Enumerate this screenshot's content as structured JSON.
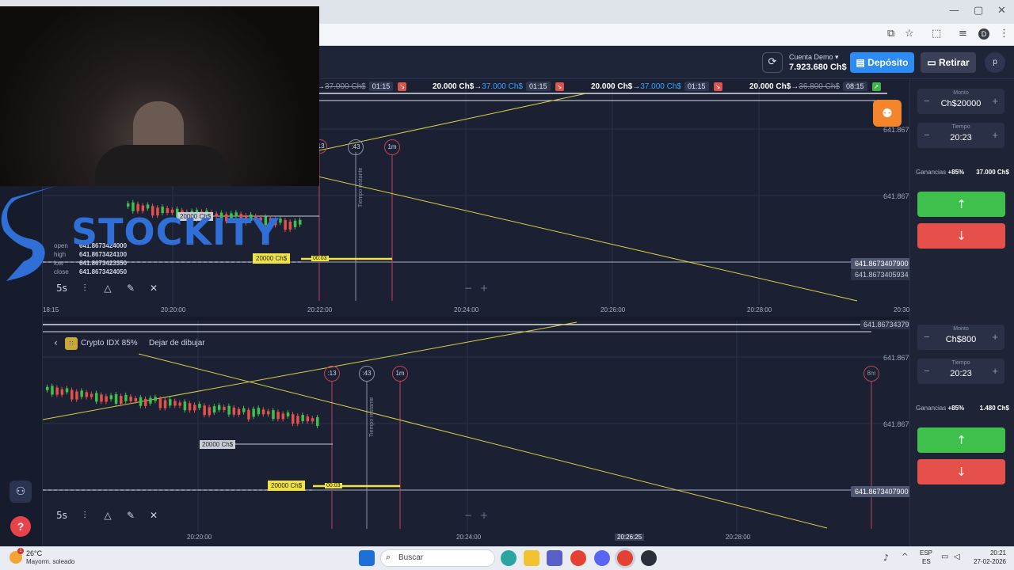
{
  "browser": {
    "window_min": "—",
    "window_max": "▢",
    "window_close": "✕",
    "profile_initial": "D"
  },
  "header": {
    "account_label": "Cuenta Demo",
    "account_balance": "7.923.680 Ch$",
    "deposit_label": "Depósito",
    "withdraw_label": "Retirar",
    "avatar_initial": "p"
  },
  "ticker": [
    {
      "from": "",
      "old": "37.000 Ch$",
      "new": "",
      "time": "01:15",
      "direction": "down"
    },
    {
      "from": "20.000 Ch$",
      "old": "",
      "new": "37.000 Ch$",
      "time": "01:15",
      "direction": "down"
    },
    {
      "from": "20.000 Ch$",
      "old": "",
      "new": "37.000 Ch$",
      "time": "01:15",
      "direction": "down"
    },
    {
      "from": "20.000 Ch$",
      "old": "36.800 Ch$",
      "new": "",
      "time": "08:15",
      "direction": "up"
    }
  ],
  "chart_top": {
    "price_labels": [
      "641.8673",
      "641.8673",
      "641.8673"
    ],
    "current_price": "641.8673407900",
    "sub_price": "641.8673405934",
    "trade_tag": "20000 Ch$",
    "trade_tag_faded": "20000 Ch$",
    "trade_timer": "00:03",
    "markers": [
      ":13",
      ":43",
      "1m"
    ],
    "vertical_label": "Tiempo restante",
    "ohlc": {
      "open": "641.8673424000",
      "high": "641.8673424100",
      "low": "641.8673423350",
      "close": "641.8673424050"
    },
    "ohlc_labels": {
      "open": "open",
      "high": "high",
      "low": "low",
      "close": "close"
    },
    "interval": "5s",
    "times": [
      "18:15",
      "20:20:00",
      "20:22:00",
      "20:24:00",
      "20:26:00",
      "20:28:00",
      "20:30"
    ]
  },
  "chart_bottom": {
    "top_price": "641.8673437963",
    "price_labels": [
      "641.8673",
      "641.8673"
    ],
    "current_price": "641.8673407900",
    "trade_tag": "20000 Ch$",
    "trade_tag_faded": "20000 Ch$",
    "trade_timer": "00:03",
    "markers": [
      ":13",
      ":43",
      "1m",
      "8m"
    ],
    "vertical_label": "Tiempo restante",
    "asset_name": "Crypto IDX 85%",
    "stop_drawing": "Dejar de dibujar",
    "interval": "5s",
    "times": [
      "20:20:00",
      "20:24:00",
      "20:26:25",
      "20:28:00"
    ]
  },
  "watermark": "STOCKITY",
  "right_panel_top": {
    "amount_label": "Monto",
    "amount_value": "Ch$20000",
    "time_label": "Tiempo",
    "time_value": "20:23",
    "gain_label": "Ganancias",
    "gain_pct": "+85%",
    "gain_amount": "37.000 Ch$",
    "up_icon": "↑",
    "down_icon": "↓"
  },
  "right_panel_bottom": {
    "amount_label": "Monto",
    "amount_value": "Ch$800",
    "time_label": "Tiempo",
    "time_value": "20:23",
    "gain_label": "Ganancias",
    "gain_pct": "+85%",
    "gain_amount": "1.480 Ch$",
    "up_icon": "↑",
    "down_icon": "↓"
  },
  "taskbar": {
    "weather_temp": "26°C",
    "weather_desc": "Mayorm. soleado",
    "weather_badge": "1",
    "search_placeholder": "Buscar",
    "lang_top": "ESP",
    "lang_bottom": "ES",
    "time": "20:21",
    "date": "27-02-2026"
  }
}
